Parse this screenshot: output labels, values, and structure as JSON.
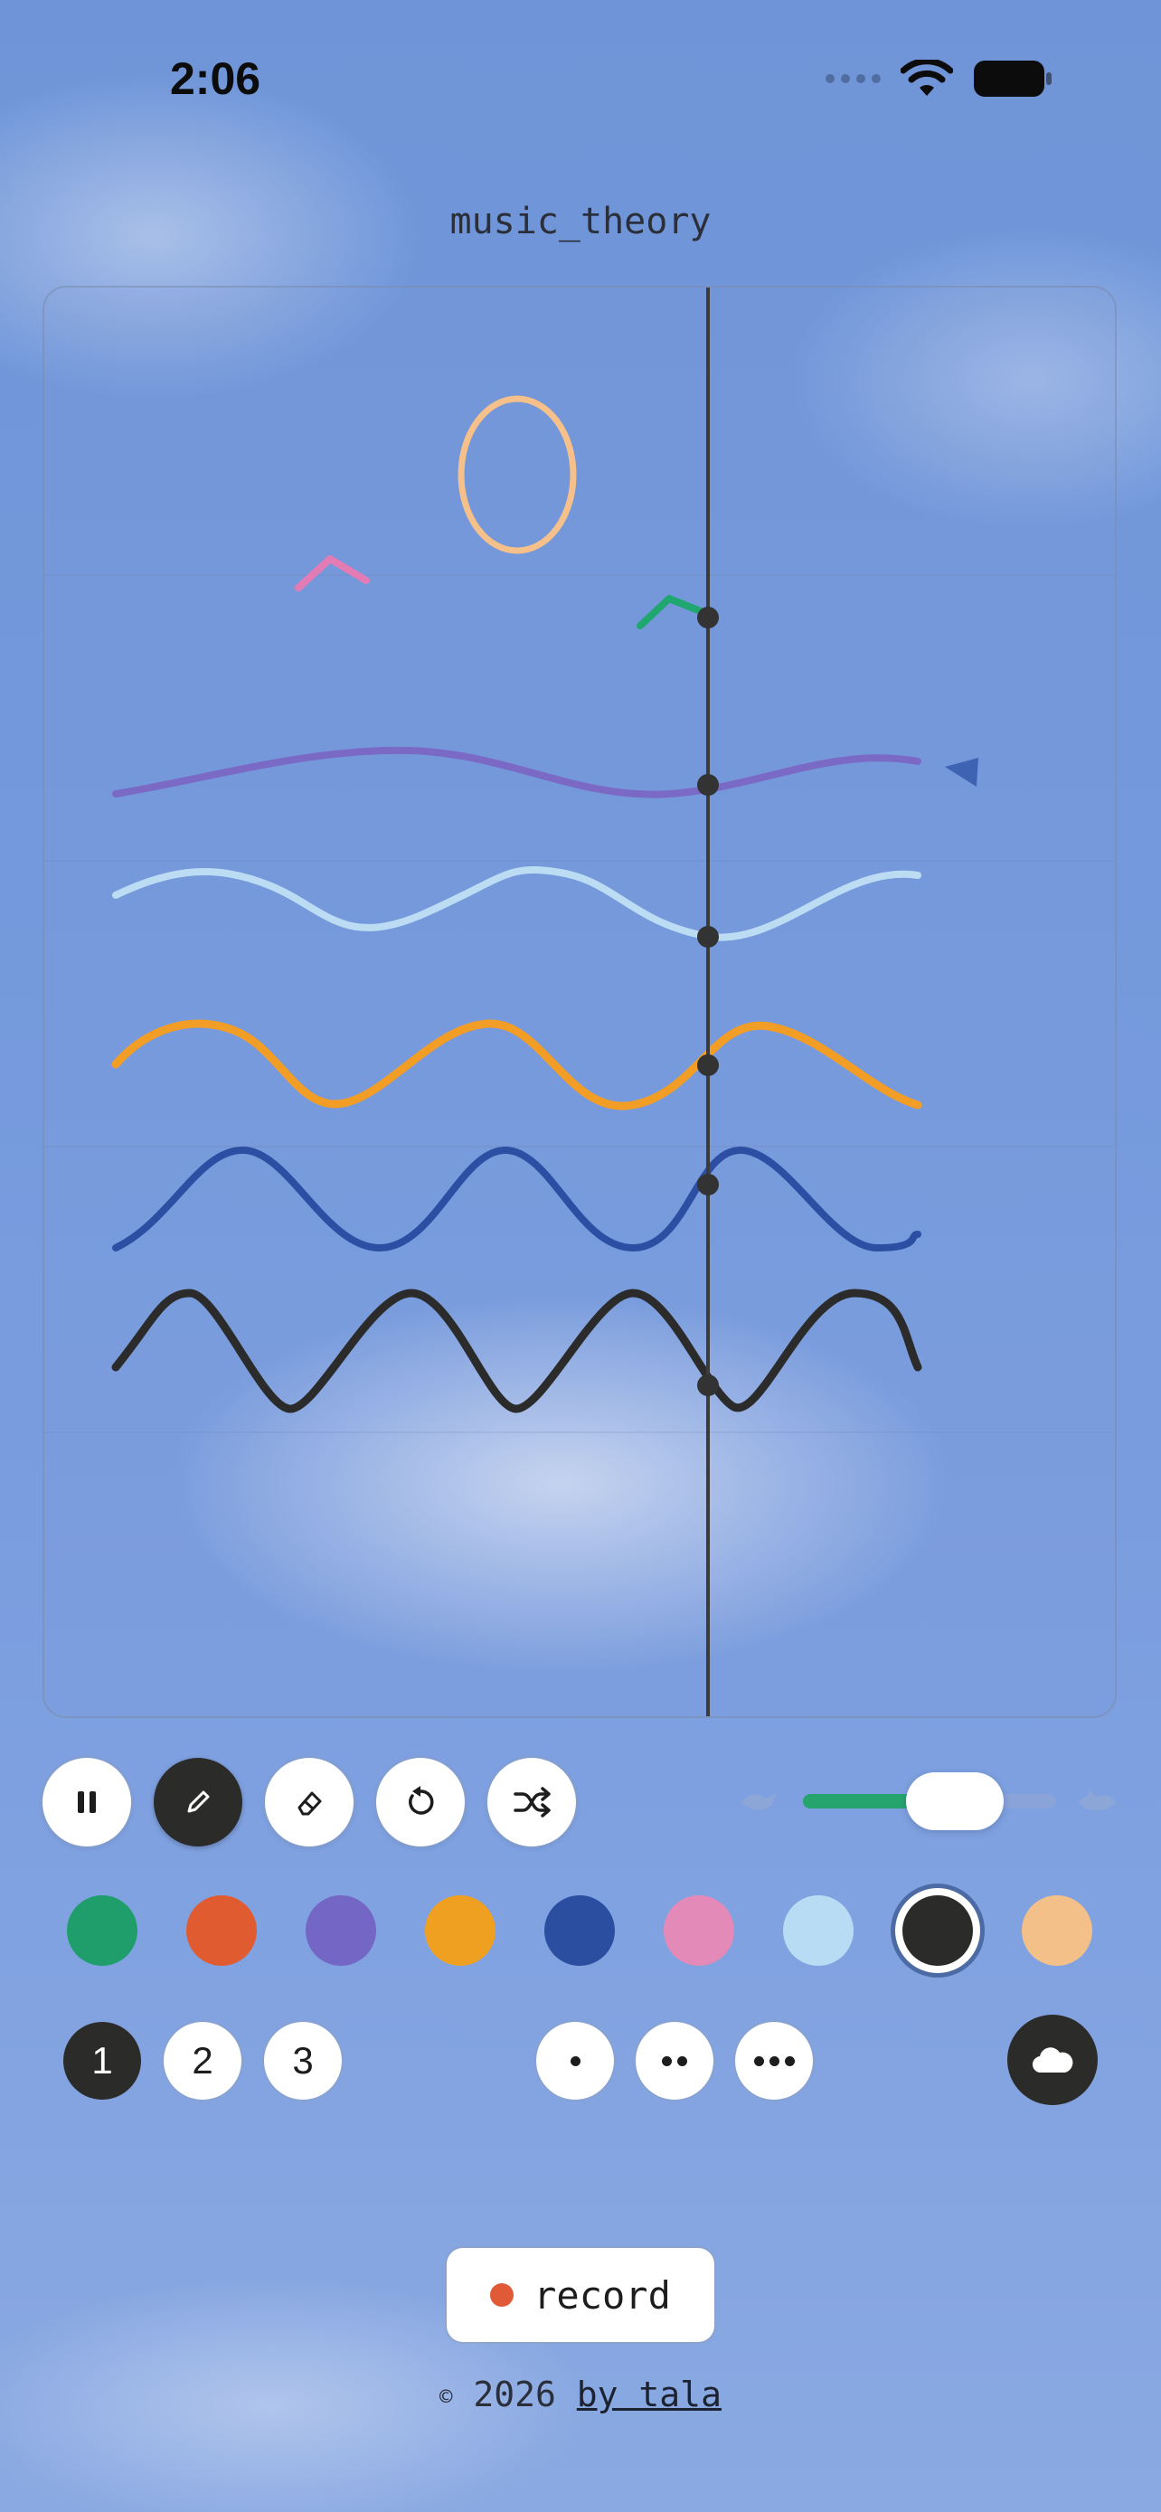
{
  "status_bar": {
    "time": "2:06",
    "icons": [
      "signal-dots-icon",
      "wifi-icon",
      "battery-icon"
    ]
  },
  "document": {
    "title": "music_theory"
  },
  "canvas": {
    "playhead_color": "#3b3b3b",
    "strokes": [
      {
        "name": "orange-ellipse",
        "color": "#f5c08a"
      },
      {
        "name": "pink-caret",
        "color": "#e37cb5"
      },
      {
        "name": "green-caret",
        "color": "#20a66f"
      },
      {
        "name": "purple-wave",
        "color": "#7b69c6"
      },
      {
        "name": "lightblue-wave",
        "color": "#bcdcf3"
      },
      {
        "name": "orange-wave",
        "color": "#f29d26"
      },
      {
        "name": "navy-wave",
        "color": "#2d4fa3"
      },
      {
        "name": "black-wave",
        "color": "#2b2b2b"
      }
    ]
  },
  "toolbar": {
    "tools": [
      {
        "icon": "pause-icon",
        "active": false
      },
      {
        "icon": "pencil-icon",
        "active": true
      },
      {
        "icon": "eraser-icon",
        "active": false
      },
      {
        "icon": "undo-icon",
        "active": false
      },
      {
        "icon": "shuffle-icon",
        "active": false
      }
    ],
    "tempo_slider": {
      "value_percent": 60,
      "min_icon": "slow-icon",
      "max_icon": "fast-icon"
    }
  },
  "palette": {
    "colors": [
      "#1f9e6c",
      "#e05c30",
      "#7466c4",
      "#f0a020",
      "#2c4ea0",
      "#e38ab8",
      "#b8dcf3",
      "#2b2b29",
      "#f4c08a"
    ],
    "selected_index": 7
  },
  "layers": {
    "items": [
      "1",
      "2",
      "3"
    ],
    "active_index": 0
  },
  "brush_sizes": {
    "options": [
      1,
      2,
      3
    ],
    "icon": "dots-icon"
  },
  "cloud": {
    "icon": "cloud-icon"
  },
  "record": {
    "label": "record"
  },
  "footer": {
    "copyright": "©",
    "year": "2026",
    "author": "by tala"
  }
}
